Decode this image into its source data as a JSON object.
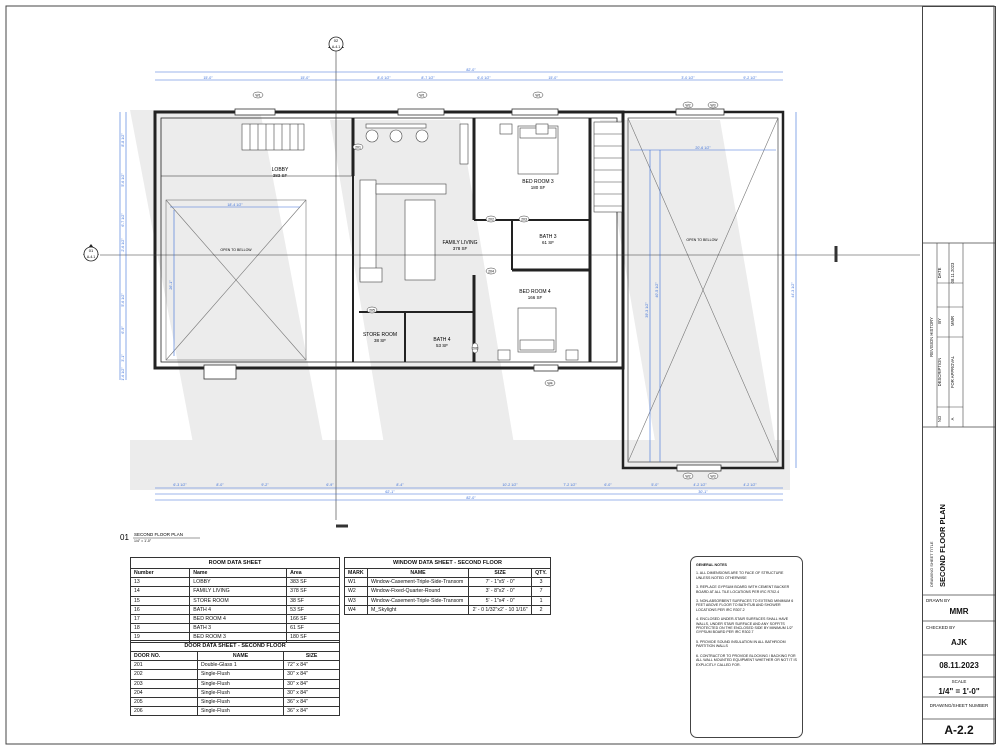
{
  "floor_plan": {
    "rooms": [
      {
        "name": "LOBBY",
        "area": "383 SF"
      },
      {
        "name": "FAMILY LIVING",
        "area": "378 SF"
      },
      {
        "name": "BED ROOM 3",
        "area": "180 SF"
      },
      {
        "name": "BATH 3",
        "area": "61 SF"
      },
      {
        "name": "BED ROOM 4",
        "area": "166 SF"
      },
      {
        "name": "STORE ROOM",
        "area": "38 SF"
      },
      {
        "name": "BATH 4",
        "area": "53 SF"
      }
    ],
    "open_to_below": "OPEN TO BELLOW",
    "top_dims": [
      "15'-0\"",
      "15'-0\"",
      "8'-0 1/2\"",
      "8'-7 1/2\"",
      "6'-0 1/2\"",
      "15'-0\"",
      "3'-0 1/2\"",
      "9'-2 1/2\""
    ],
    "overall_dim": "82'-0\"",
    "bottom_dims": [
      "6'-3 1/2\"",
      "8'-0\"",
      "9'-2\"",
      "6'-9\"",
      "8'-4\"",
      "10'-2 1/2\"",
      "7'-2 1/2\"",
      "6'-0\"",
      "5'-0\"",
      "4'-2 1/2\"",
      "4'-2 1/2\""
    ],
    "bottom_total_1": "62'-1\"",
    "bottom_total_2": "82'-0\"",
    "bottom_total_3": "30'-1\"",
    "left_dims": [
      "8'-8 1/2\"",
      "5'-6 1/2\"",
      "6'-7 1/2\"",
      "2'-6 1/2\"",
      "5'-6 1/2\"",
      "6'-9\"",
      "3'-1\"",
      "1'-6 1/2\""
    ],
    "right_dim": "44'-3 1/2\"",
    "right_inner_dim": "39'-3 1/2\"",
    "right_inner_dim2": "40'-5 1/2\"",
    "open_dim_left": "18'-4 1/2\"",
    "open_dim_left_v": "26'-1\"",
    "open_dim_right": "20'-6 1/2\"",
    "section_top": {
      "num": "02",
      "sheet": "A-4.1"
    },
    "section_left": {
      "num": "01",
      "sheet": "A-4.1"
    },
    "windows_top": [
      "W1",
      "W1",
      "W1",
      "W2",
      "W3"
    ],
    "window_bottom": "W4",
    "windows_right_bottom": [
      "W2",
      "W3"
    ],
    "doors": [
      "201",
      "202",
      "203",
      "204",
      "205",
      "206"
    ]
  },
  "plan_label": {
    "num": "01",
    "title": "SECOND FLOOR PLAN",
    "scale": "1/4\" = 1'-0\""
  },
  "room_sheet": {
    "title": "ROOM DATA SHEET",
    "headers": [
      "Number",
      "Name",
      "Area"
    ],
    "rows": [
      [
        "13",
        "LOBBY",
        "383 SF"
      ],
      [
        "14",
        "FAMILY LIVING",
        "378 SF"
      ],
      [
        "15",
        "STORE ROOM",
        "38 SF"
      ],
      [
        "16",
        "BATH 4",
        "53 SF"
      ],
      [
        "17",
        "BED ROOM 4",
        "166 SF"
      ],
      [
        "18",
        "BATH 3",
        "61 SF"
      ],
      [
        "19",
        "BED ROOM 3",
        "180 SF"
      ]
    ]
  },
  "door_sheet": {
    "title": "DOOR DATA SHEET - SECOND FLOOR",
    "headers": [
      "DOOR NO.",
      "NAME",
      "SIZE"
    ],
    "rows": [
      [
        "201",
        "Double-Glass 1",
        "72\" x 84\""
      ],
      [
        "202",
        "Single-Flush",
        "30\" x 84\""
      ],
      [
        "203",
        "Single-Flush",
        "30\" x 84\""
      ],
      [
        "204",
        "Single-Flush",
        "30\" x 84\""
      ],
      [
        "205",
        "Single-Flush",
        "36\" x 84\""
      ],
      [
        "206",
        "Single-Flush",
        "36\" x 84\""
      ]
    ]
  },
  "window_sheet": {
    "title": "WINDOW DATA SHEET - SECOND FLOOR",
    "headers": [
      "MARK",
      "NAME",
      "SIZE",
      "QTY."
    ],
    "rows": [
      [
        "W1",
        "Window-Casement-Triple-Side-Transom",
        "7' - 1\"x5' - 0\"",
        "3"
      ],
      [
        "W2",
        "Window-Fixed-Quarter-Round",
        "3' - 8\"x2' - 0\"",
        "7"
      ],
      [
        "W3",
        "Window-Casement-Triple-Side-Transom",
        "5' - 1\"x4' - 0\"",
        "1"
      ],
      [
        "W4",
        "M_Skylight",
        "2' - 0 1/32\"x2' - 10 1/16\"",
        "2"
      ]
    ]
  },
  "notes": {
    "title": "GENERAL NOTES",
    "items": [
      "1. ALL DIMENSIONS ARE TO FACE OF STRUCTURE UNLESS NOTED OTHERWISE",
      "3. REPLACE GYPSUM BOARD WITH CEMENT BACKER BOARD AT ALL TILE LOCATIONS PER IRC R702.4",
      "3. NON-ABSORBENT SURFACES TO EXTEND MINIMUM 6 FEET ABOVE FLOOR TO BATHTUB AND SHOWER LOCATIONS PER IRC R307.2",
      "4. ENCLOSED UNDER-STAIR SURFACES SHALL HAVE WALLS, UNDER STAIR SURFACE AND ANY SOFFITS PROTECTED ON THE ENCLOSED SIDE BY MINIMUM 1/2\" GYPSUM BOARD PER IRC R302.7",
      "5. PROVIDE SOUND INSULATION IN ALL BATHROOM PARTITION WALLS",
      "6. CONTRACTOR TO PROVIDE BLOCKING / BACKING FOR ALL WALL MOUNTED EQUIPMENT WHETHER OR NOT IT IS EXPLICITLY CALLED FOR."
    ]
  },
  "title_block": {
    "revision_title": "REVISION HISTORY",
    "rev_headers": [
      "NO",
      "DESCRIPTION",
      "BY",
      "DATE"
    ],
    "rev_row": [
      "A",
      "FOR APPROVAL",
      "MMR",
      "08.11.2023"
    ],
    "drawing_title_label": "DRAWING SHEET TITLE",
    "drawing_title": "SECOND FLOOR PLAN",
    "drawn_by_label": "DRAWN BY",
    "drawn_by": "MMR",
    "checked_by_label": "CHECKED BY",
    "checked_by": "AJK",
    "date": "08.11.2023",
    "scale_label": "SCALE",
    "scale": "1/4\" = 1'-0\"",
    "sheet_label": "DRAWING/SHEET NUMBER",
    "sheet_number": "A-2.2"
  }
}
